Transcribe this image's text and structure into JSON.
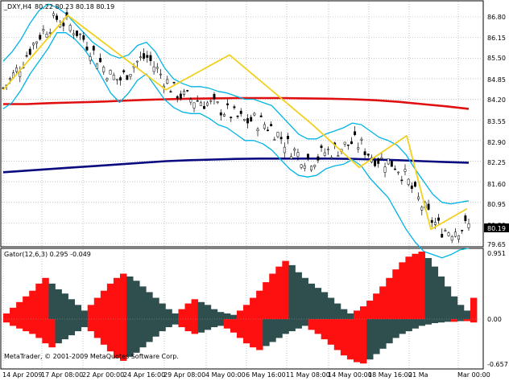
{
  "main_chart": {
    "symbol_label": "_DXY,H4",
    "ohlc_label": "80.22 80.23 80.18 80.19",
    "price_levels": [
      "86.80",
      "86.15",
      "85.50",
      "84.85",
      "84.20",
      "83.55",
      "82.90",
      "82.25",
      "81.60",
      "80.95",
      "80.30",
      "79.65"
    ],
    "current_price": "80.19",
    "ylim": [
      79.4,
      87.2
    ],
    "colors": {
      "bollinger": "#00b4e6",
      "ma_red": "#e01010",
      "ma_navy": "#0a0a80",
      "zigzag": "#f2d020",
      "candle": "#000000",
      "grid": "#a0a0a0"
    }
  },
  "gator": {
    "label": "Gator(12,6,3) 0.295 -0.049",
    "levels": [
      "0.951",
      "0.00",
      "-0.657"
    ],
    "colors": {
      "up": "#ff1010",
      "down": "#2f4f4f"
    }
  },
  "watermark": "MetaTrader, © 2001-2009 MetaQuotes Software Corp.",
  "time_axis": [
    "14 Apr 2009",
    "17 Apr 08:00",
    "22 Apr 00:00",
    "24 Apr 16:00",
    "29 Apr 08:00",
    "4 May 00:00",
    "6 May 16:00",
    "11 May 08:00",
    "14 May 00:00",
    "18 May 16:00",
    "21 Ma",
    "Mar 00:00"
  ],
  "chart_data": [
    {
      "type": "line",
      "title": "",
      "series": [
        {
          "values": [
            84.55,
            84.9,
            85.3,
            85.8,
            86.2,
            86.5,
            86.75,
            86.6,
            86.4,
            86.1,
            85.7,
            85.3,
            84.95,
            84.8,
            85.1,
            85.4,
            85.55,
            85.2,
            84.85,
            84.5,
            84.3,
            84.2,
            84.15,
            84.05,
            83.95,
            83.8,
            83.65,
            83.5,
            83.55,
            83.45,
            83.3,
            83.0,
            82.7,
            82.45,
            82.3,
            82.35,
            82.55,
            82.6,
            82.7,
            82.85,
            82.75,
            82.45,
            82.3,
            82.25,
            82.1,
            81.7,
            81.2,
            80.75,
            80.35,
            80.1,
            80.05,
            80.15,
            80.2
          ]
        },
        {
          "values": [
            85.4,
            85.7,
            86.1,
            86.6,
            87.0,
            87.2,
            87.1,
            86.9,
            86.6,
            86.3,
            86.0,
            85.8,
            85.6,
            85.5,
            85.6,
            85.9,
            86.0,
            85.7,
            85.2,
            84.85,
            84.7,
            84.6,
            84.6,
            84.55,
            84.45,
            84.4,
            84.3,
            84.2,
            84.2,
            84.1,
            84.0,
            83.7,
            83.4,
            83.1,
            82.95,
            82.95,
            83.1,
            83.2,
            83.3,
            83.45,
            83.4,
            83.2,
            83.0,
            82.9,
            82.75,
            82.45,
            82.0,
            81.6,
            81.2,
            80.95,
            80.9,
            80.95,
            81.0
          ]
        },
        {
          "values": [
            83.9,
            84.1,
            84.5,
            85.0,
            85.4,
            85.8,
            86.3,
            86.3,
            86.1,
            85.8,
            85.4,
            84.9,
            84.4,
            84.1,
            84.4,
            84.8,
            85.0,
            84.6,
            84.2,
            83.95,
            83.8,
            83.75,
            83.75,
            83.6,
            83.4,
            83.3,
            83.1,
            82.9,
            82.9,
            82.8,
            82.6,
            82.3,
            82.0,
            81.8,
            81.75,
            81.8,
            82.0,
            82.1,
            82.15,
            82.3,
            82.1,
            81.7,
            81.4,
            81.1,
            80.6,
            80.1,
            79.7,
            79.4,
            79.3,
            79.2,
            79.3,
            79.45,
            79.5
          ]
        },
        {
          "values": [
            84.05,
            84.05,
            84.08,
            84.1,
            84.12,
            84.15,
            84.18,
            84.2,
            84.22,
            84.23,
            84.24,
            84.24,
            84.24,
            84.23,
            84.22,
            84.2,
            84.17,
            84.12,
            84.05,
            83.98,
            83.9
          ]
        },
        {
          "values": [
            81.9,
            81.95,
            82.0,
            82.05,
            82.1,
            82.15,
            82.2,
            82.25,
            82.28,
            82.3,
            82.32,
            82.33,
            82.33,
            82.33,
            82.33,
            82.32,
            82.3,
            82.28,
            82.25,
            82.22,
            82.2
          ]
        },
        {
          "values": [
            84.5,
            86.85,
            84.5,
            85.6,
            83.4,
            82.05,
            83.05,
            80.1,
            80.75
          ]
        }
      ]
    },
    {
      "type": "bar",
      "title": "",
      "series": [
        {
          "values": [
            0.08,
            0.16,
            0.24,
            0.32,
            0.4,
            0.5,
            0.58,
            0.5,
            0.42,
            0.36,
            0.28,
            0.2,
            0.12,
            0.2,
            0.3,
            0.4,
            0.5,
            0.58,
            0.64,
            0.6,
            0.54,
            0.46,
            0.38,
            0.3,
            0.22,
            0.14,
            0.08,
            0.14,
            0.22,
            0.28,
            0.24,
            0.2,
            0.14,
            0.1,
            0.08,
            0.06,
            0.12,
            0.2,
            0.3,
            0.4,
            0.52,
            0.64,
            0.74,
            0.82,
            0.76,
            0.66,
            0.58,
            0.5,
            0.44,
            0.38,
            0.3,
            0.22,
            0.14,
            0.08,
            0.12,
            0.18,
            0.26,
            0.36,
            0.46,
            0.58,
            0.7,
            0.8,
            0.88,
            0.92,
            0.95,
            0.86,
            0.74,
            0.6,
            0.46,
            0.32,
            0.2,
            0.12,
            0.3
          ]
        },
        {
          "values": [
            -0.05,
            -0.1,
            -0.14,
            -0.18,
            -0.22,
            -0.28,
            -0.36,
            -0.42,
            -0.36,
            -0.3,
            -0.24,
            -0.18,
            -0.12,
            -0.18,
            -0.28,
            -0.38,
            -0.48,
            -0.58,
            -0.62,
            -0.56,
            -0.5,
            -0.42,
            -0.34,
            -0.26,
            -0.18,
            -0.12,
            -0.08,
            -0.12,
            -0.18,
            -0.22,
            -0.2,
            -0.16,
            -0.12,
            -0.1,
            -0.14,
            -0.2,
            -0.28,
            -0.36,
            -0.42,
            -0.46,
            -0.4,
            -0.34,
            -0.28,
            -0.22,
            -0.18,
            -0.14,
            -0.1,
            -0.16,
            -0.22,
            -0.3,
            -0.38,
            -0.46,
            -0.54,
            -0.6,
            -0.64,
            -0.66,
            -0.6,
            -0.52,
            -0.44,
            -0.36,
            -0.28,
            -0.22,
            -0.18,
            -0.14,
            -0.1,
            -0.08,
            -0.06,
            -0.05,
            -0.04,
            -0.04,
            -0.03,
            -0.03,
            -0.05
          ]
        }
      ]
    }
  ]
}
